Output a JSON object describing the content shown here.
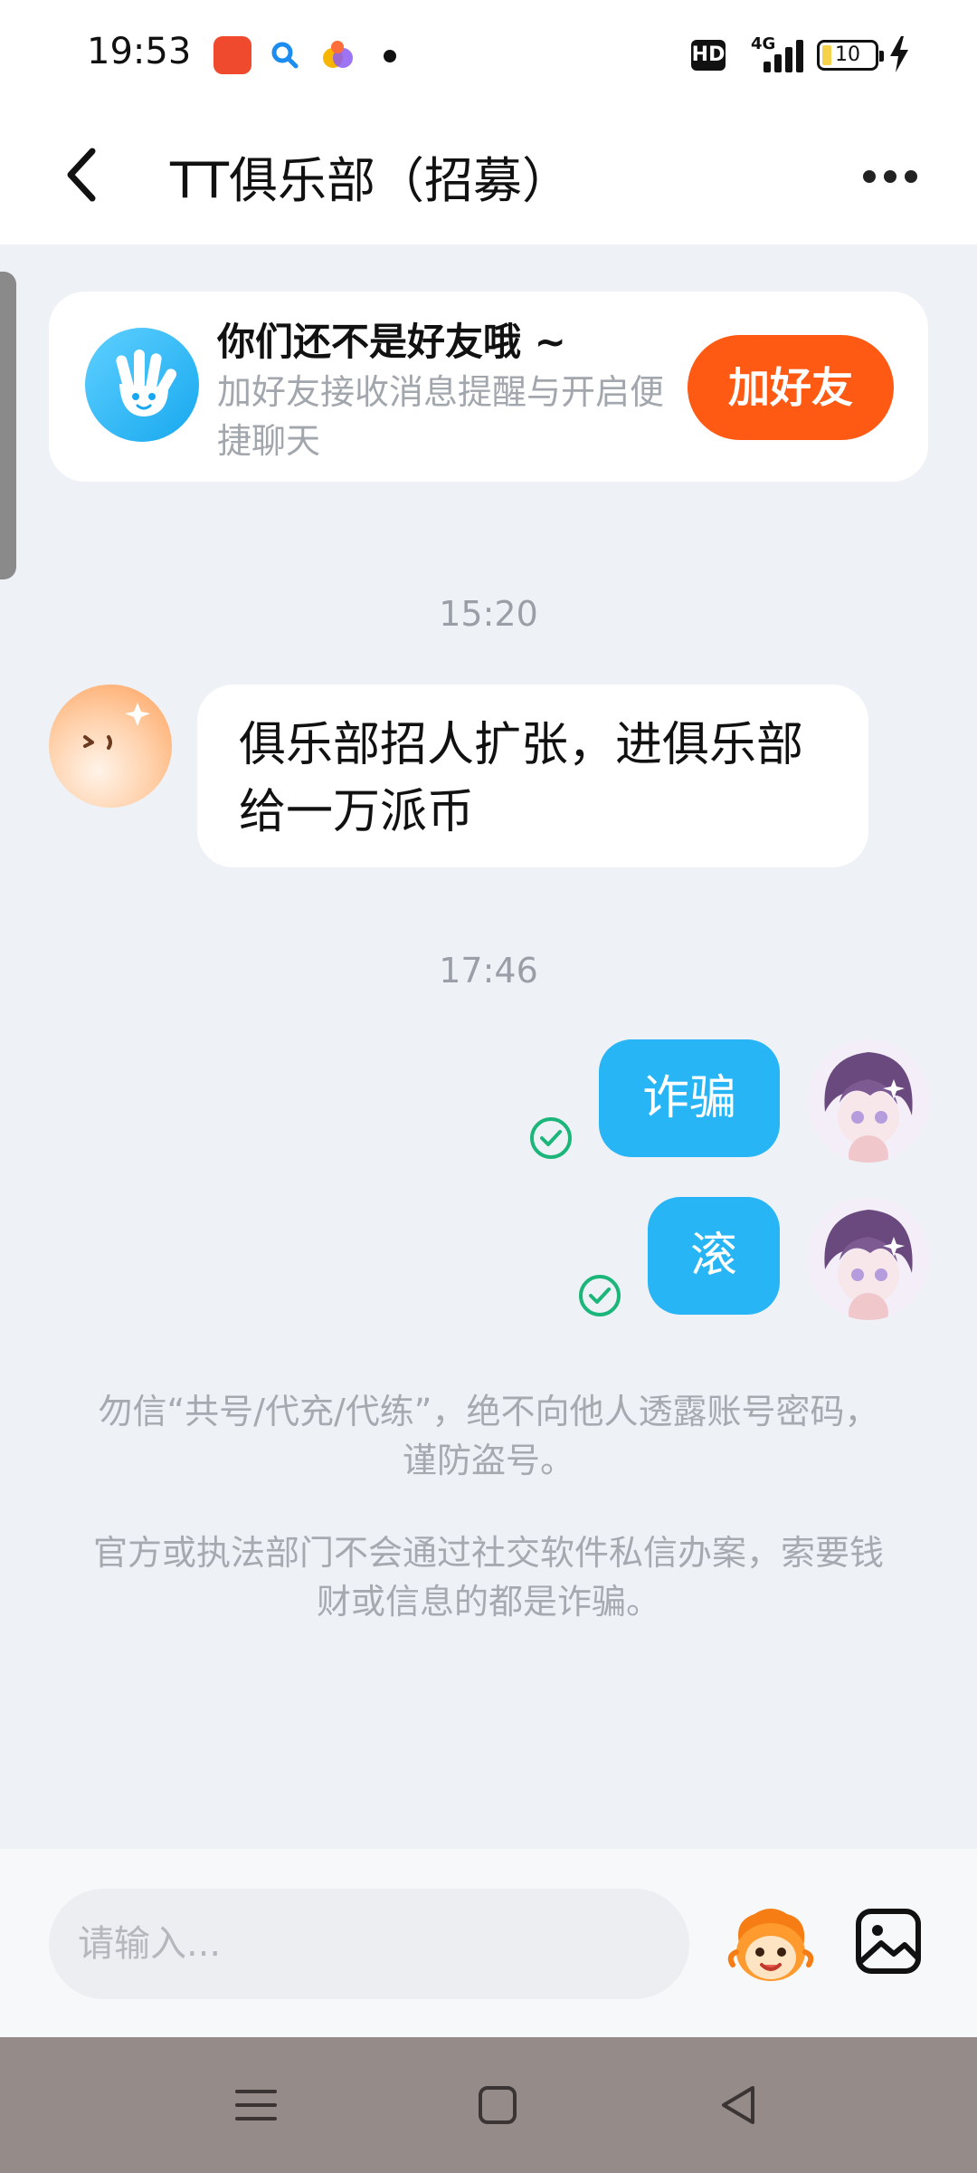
{
  "status_bar": {
    "time": "19:53",
    "hd_label": "HD",
    "network": "4G",
    "battery": "10",
    "apps": [
      "red-app-icon",
      "search-app-icon",
      "colorful-app-icon"
    ]
  },
  "header": {
    "title": "TT俱乐部（招募）"
  },
  "friend_card": {
    "title": "你们还不是好友哦 ~",
    "subtitle": "加好友接收消息提醒与开启便捷聊天",
    "button": "加好友"
  },
  "messages": [
    {
      "type": "time",
      "text": "15:20"
    },
    {
      "type": "incoming",
      "text": "俱乐部招人扩张，进俱乐部给一万派币"
    },
    {
      "type": "time",
      "text": "17:46"
    },
    {
      "type": "outgoing",
      "text": "诈骗",
      "status": "read"
    },
    {
      "type": "outgoing",
      "text": "滚",
      "status": "read"
    }
  ],
  "tips": [
    "勿信“共号/代充/代练”，绝不向他人透露账号密码，谨防盗号。",
    "官方或执法部门不会通过社交软件私信办案，索要钱财或信息的都是诈骗。"
  ],
  "input": {
    "placeholder": "请输入..."
  },
  "colors": {
    "accent_blue": "#27b5f6",
    "add_friend_orange": "#fe5a14",
    "read_check_green": "#1db67a",
    "background": "#eef2f7"
  }
}
